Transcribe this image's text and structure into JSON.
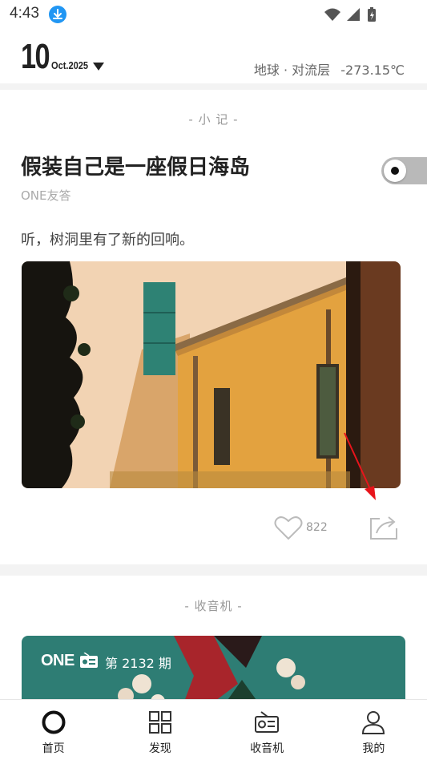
{
  "status_bar": {
    "time": "4:43"
  },
  "header": {
    "day": "10",
    "month_year": "Oct.2025",
    "location": "地球 · 对流层",
    "temperature": "-273.15℃"
  },
  "note_card": {
    "section_label": "- 小 记 -",
    "title": "假装自己是一座假日海岛",
    "author": "ONE友答",
    "description": "听，树洞里有了新的回响。",
    "like_count": "822"
  },
  "radio_card": {
    "section_label": "- 收音机 -",
    "brand": "ONE",
    "episode": "第 2132 期"
  },
  "bottom_nav": {
    "items": [
      {
        "label": "首页"
      },
      {
        "label": "发现"
      },
      {
        "label": "收音机"
      },
      {
        "label": "我的"
      }
    ]
  },
  "colors": {
    "accent_arrow": "#e8141b",
    "status_download": "#2196f3",
    "radio_bg": "#2e7d74"
  }
}
